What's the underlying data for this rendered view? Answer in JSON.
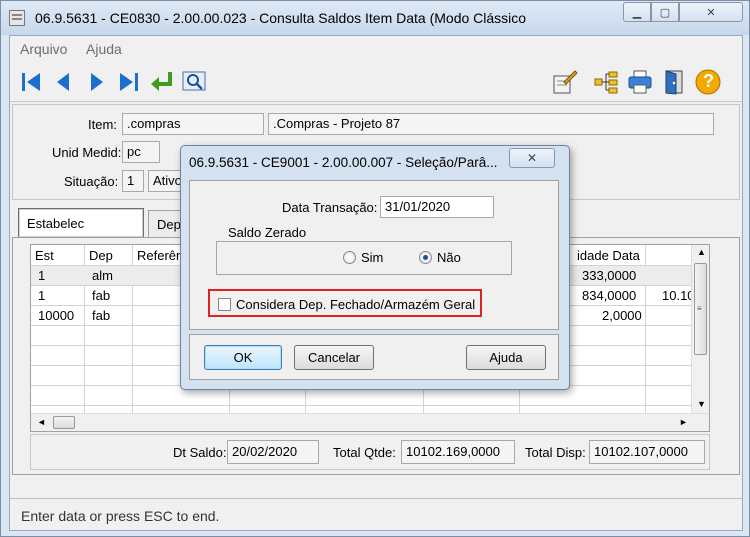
{
  "window": {
    "title": "06.9.5631 - CE0830 - 2.00.00.023 - Consulta Saldos Item Data (Modo Clássico"
  },
  "menu": {
    "arquivo": "Arquivo",
    "ajuda": "Ajuda"
  },
  "toolbar": {
    "icons": [
      "first-icon",
      "previous-icon",
      "next-icon",
      "last-icon",
      "goto-icon",
      "zoom-icon",
      "edit-icon",
      "tree-icon",
      "print-icon",
      "exit-icon",
      "help-icon"
    ],
    "help_glyph": "?"
  },
  "form": {
    "item_label": "Item:",
    "item_code": ".compras",
    "item_desc": ".Compras - Projeto 87",
    "unid_label": "Unid Medid:",
    "unid_value": "pc",
    "situacao_label": "Situação:",
    "situacao_code": "1",
    "situacao_desc": "Ativo"
  },
  "tabs": {
    "estabelec": "Estabelec",
    "dep": "Depo"
  },
  "grid": {
    "headers": {
      "est": "Est",
      "dep": "Dep",
      "ref": "Referênc",
      "qtd_data": "idade Data"
    },
    "rows": [
      {
        "est": "1",
        "dep": "alm",
        "qtd": "333,0000",
        "extra": ""
      },
      {
        "est": "1",
        "dep": "fab",
        "qtd": "834,0000",
        "extra": "10.10"
      },
      {
        "est": "10000",
        "dep": "fab",
        "qtd": "2,0000",
        "extra": ""
      }
    ]
  },
  "totals": {
    "dt_saldo_label": "Dt Saldo:",
    "dt_saldo_value": "20/02/2020",
    "total_qtde_label": "Total Qtde:",
    "total_qtde_value": "10102.169,0000",
    "total_disp_label": "Total Disp:",
    "total_disp_value": "10102.107,0000"
  },
  "status": {
    "text": "Enter data or press ESC to end."
  },
  "dialog": {
    "title": "06.9.5631 - CE9001 - 2.00.00.007 - Seleção/Parâ...",
    "data_transacao_label": "Data Transação:",
    "data_transacao_value": "31/01/2020",
    "saldo_zerado_label": "Saldo Zerado",
    "sim_label": "Sim",
    "nao_label": "Não",
    "saldo_zerado_selected": "Não",
    "considera_label": "Considera Dep. Fechado/Armazém Geral",
    "considera_checked": false,
    "ok_label": "OK",
    "cancelar_label": "Cancelar",
    "ajuda_label": "Ajuda"
  },
  "colors": {
    "accent": "#1c6fd1",
    "highlight": "#dd2222",
    "titlebar": "#c7d8ec"
  }
}
